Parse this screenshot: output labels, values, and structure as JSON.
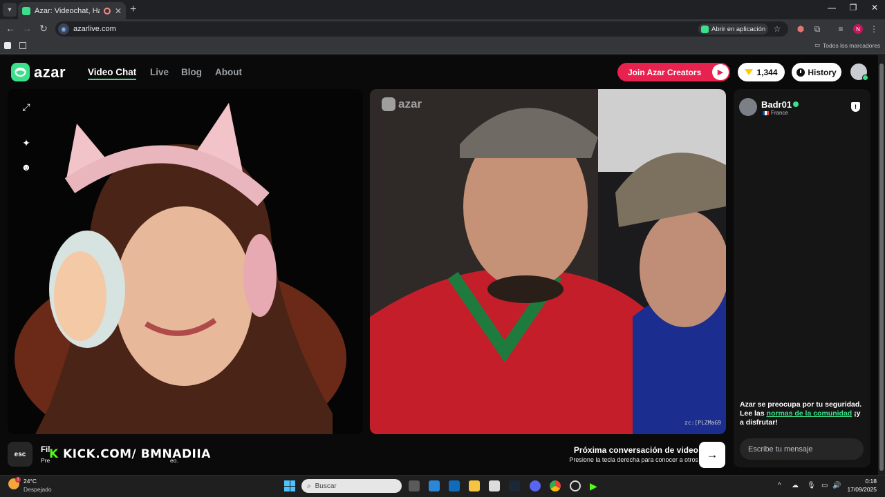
{
  "browser": {
    "tab_title": "Azar: Videochat, Haz nuevo",
    "url": "azarlive.com",
    "open_in_app": "Abrir en aplicación",
    "all_bookmarks": "Todos los marcadores",
    "profile_initial": "N"
  },
  "nav": {
    "logo_text": "azar",
    "links": [
      "Video Chat",
      "Live",
      "Blog",
      "About"
    ],
    "join_creators": "Join Azar Creators",
    "gems": "1,344",
    "history": "History"
  },
  "remote": {
    "watermark": "azar",
    "code": "zc:[PLZMaG9"
  },
  "chat": {
    "peer_name": "Badr01",
    "peer_country": "France",
    "safety_prefix": "Azar se preocupa por tu seguridad. Lee las ",
    "safety_link": "normas de la comunidad",
    "safety_suffix": " ¡y a disfrutar!",
    "input_placeholder": "Escribe tu mensaje"
  },
  "bottom": {
    "esc": "esc",
    "filter_title": "Fil",
    "filter_sub": "Pre",
    "filter_sub_tail": "eo.",
    "overlay_k": "K",
    "overlay_text": "KICK.COM/ BMNADIIA",
    "next_title": "Próxima conversación de video",
    "next_sub": "Presione la tecla derecha para conocer a otros"
  },
  "taskbar": {
    "temperature": "24°C",
    "condition": "Despejado",
    "weather_badge": "1",
    "search": "Buscar",
    "time": "0:18",
    "date": "17/09/2025"
  },
  "colors": {
    "accent": "#3be08a",
    "creators": "#e7224f"
  }
}
